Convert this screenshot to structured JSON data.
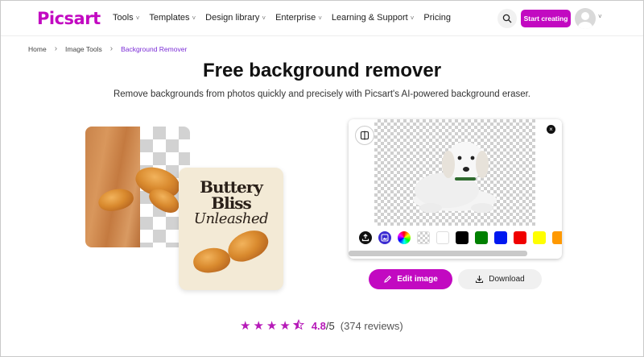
{
  "header": {
    "logo": "Picsart",
    "nav": [
      {
        "label": "Tools",
        "has_dropdown": true
      },
      {
        "label": "Templates",
        "has_dropdown": true
      },
      {
        "label": "Design library",
        "has_dropdown": true
      },
      {
        "label": "Enterprise",
        "has_dropdown": true
      },
      {
        "label": "Learning & Support",
        "has_dropdown": true
      },
      {
        "label": "Pricing",
        "has_dropdown": false
      }
    ],
    "search_icon": "search-icon",
    "cta": "Start creating"
  },
  "breadcrumb": [
    "Home",
    "Image Tools",
    "Background Remover"
  ],
  "hero": {
    "title": "Free background remover",
    "subtitle": "Remove backgrounds from photos quickly and precisely with Picsart's AI-powered background eraser."
  },
  "poster": {
    "line1": "Buttery",
    "line2": "Bliss",
    "line3": "Unleashed"
  },
  "editor": {
    "swatches": [
      {
        "type": "upload",
        "color": "#111111",
        "icon": "upload-icon"
      },
      {
        "type": "ai",
        "color": "#3b2bd1",
        "icon": "ai-image-icon"
      },
      {
        "type": "picker",
        "color": "conic",
        "icon": "color-wheel-icon"
      },
      {
        "type": "transparent",
        "color": "checker"
      },
      {
        "type": "color",
        "color": "#ffffff"
      },
      {
        "type": "color",
        "color": "#000000"
      },
      {
        "type": "color",
        "color": "#008000"
      },
      {
        "type": "color",
        "color": "#0018f0"
      },
      {
        "type": "color",
        "color": "#f00000"
      },
      {
        "type": "color",
        "color": "#ffff00"
      },
      {
        "type": "color",
        "color": "#ff9900"
      }
    ]
  },
  "actions": {
    "edit": "Edit image",
    "download": "Download"
  },
  "rating": {
    "value": "4.8",
    "max": "/5",
    "count": "(374 reviews)",
    "stars": 4.5
  },
  "colors": {
    "brand": "#c209c1",
    "breadcrumb_active": "#7b2dd6"
  }
}
